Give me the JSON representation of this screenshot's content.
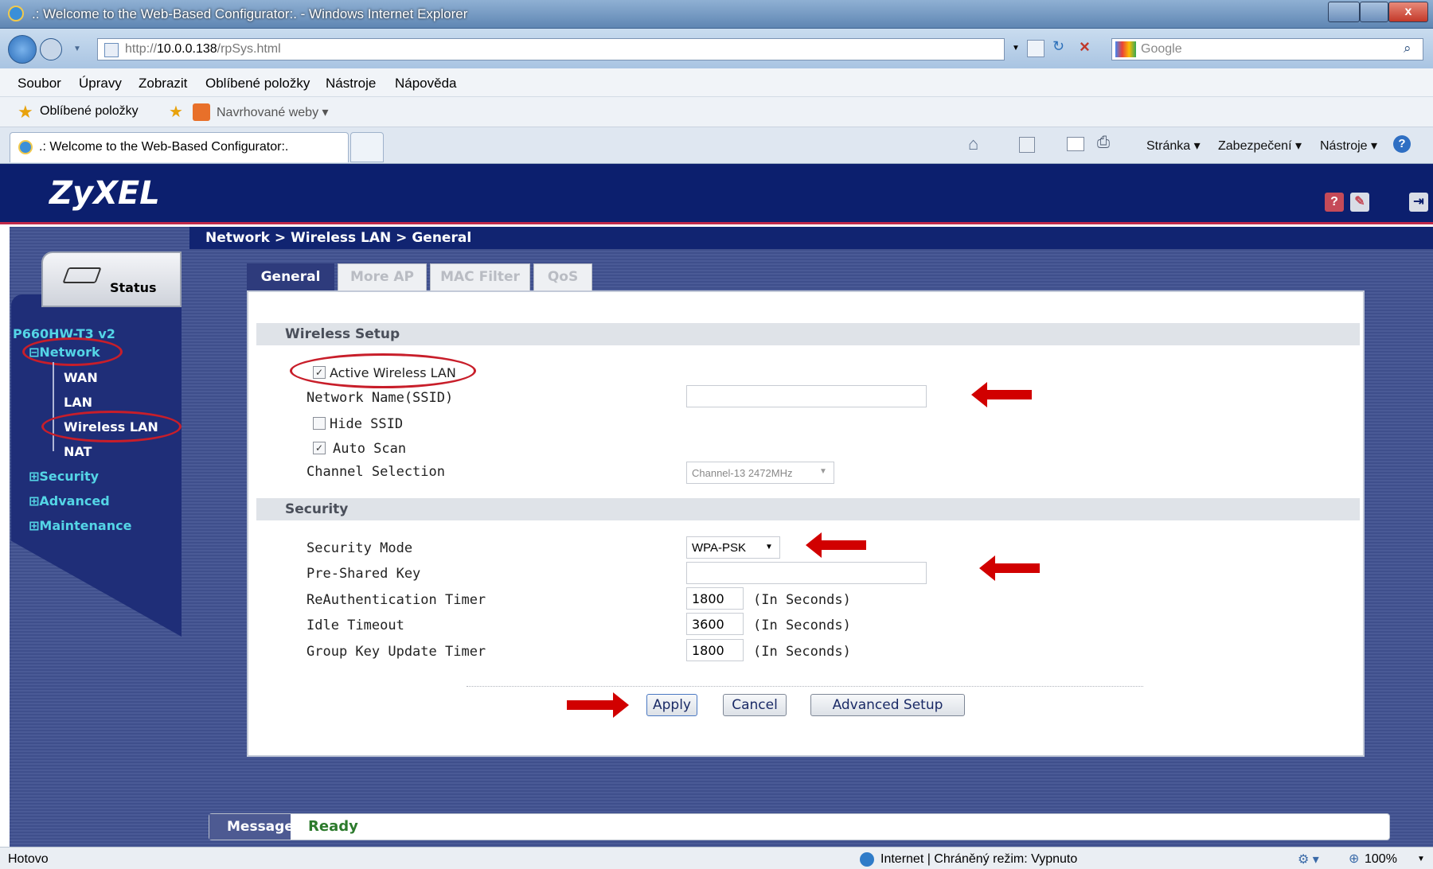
{
  "window": {
    "title": ".: Welcome to the Web-Based Configurator:. - Windows Internet Explorer"
  },
  "address": {
    "url_prefix": "http://",
    "url_host": "10.0.0.138",
    "url_path": "/rpSys.html",
    "search_placeholder": "Google"
  },
  "menu": [
    "Soubor",
    "Úpravy",
    "Zobrazit",
    "Oblíbené položky",
    "Nástroje",
    "Nápověda"
  ],
  "favorites": {
    "label": "Oblíbené položky",
    "suggested": "Navrhované weby ▾"
  },
  "tab": {
    "title": ".: Welcome to the Web-Based Configurator:."
  },
  "commandbar": {
    "page": "Stránka ▾",
    "security": "Zabezpečení ▾",
    "tools": "Nástroje ▾"
  },
  "router": {
    "logo": "ZyXEL",
    "status_label": "Status",
    "model": "P660HW-T3 v2",
    "breadcrumb": "Network > Wireless LAN > General",
    "nav": {
      "network": "Network",
      "wan": "WAN",
      "lan": "LAN",
      "wireless": "Wireless LAN",
      "nat": "NAT",
      "security": "Security",
      "advanced": "Advanced",
      "maintenance": "Maintenance"
    },
    "tabs": [
      "General",
      "More AP",
      "MAC Filter",
      "QoS"
    ],
    "wireless_setup": {
      "heading": "Wireless Setup",
      "active_label": "Active Wireless LAN",
      "active_checked": true,
      "ssid_label": "Network Name(SSID)",
      "ssid_value": "",
      "hide_ssid_label": "Hide SSID",
      "hide_ssid_checked": false,
      "auto_scan_label": "Auto Scan",
      "auto_scan_checked": true,
      "channel_label": "Channel Selection",
      "channel_value": "Channel-13 2472MHz"
    },
    "security": {
      "heading": "Security",
      "mode_label": "Security Mode",
      "mode_value": "WPA-PSK",
      "psk_label": "Pre-Shared Key",
      "psk_value": "",
      "reauth_label": "ReAuthentication Timer",
      "reauth_value": "1800",
      "idle_label": "Idle Timeout",
      "idle_value": "3600",
      "gku_label": "Group Key Update Timer",
      "gku_value": "1800",
      "unit": "(In Seconds)"
    },
    "buttons": {
      "apply": "Apply",
      "cancel": "Cancel",
      "advanced": "Advanced Setup"
    },
    "message_label": "Message",
    "message": "Ready"
  },
  "statusbar": {
    "left": "Hotovo",
    "zone": "Internet | Chráněný režim: Vypnuto",
    "zoom": "100%"
  },
  "colors": {
    "header": "#0c1f6e",
    "accent_red": "#c81e2a",
    "nav_link": "#54d5e6"
  }
}
